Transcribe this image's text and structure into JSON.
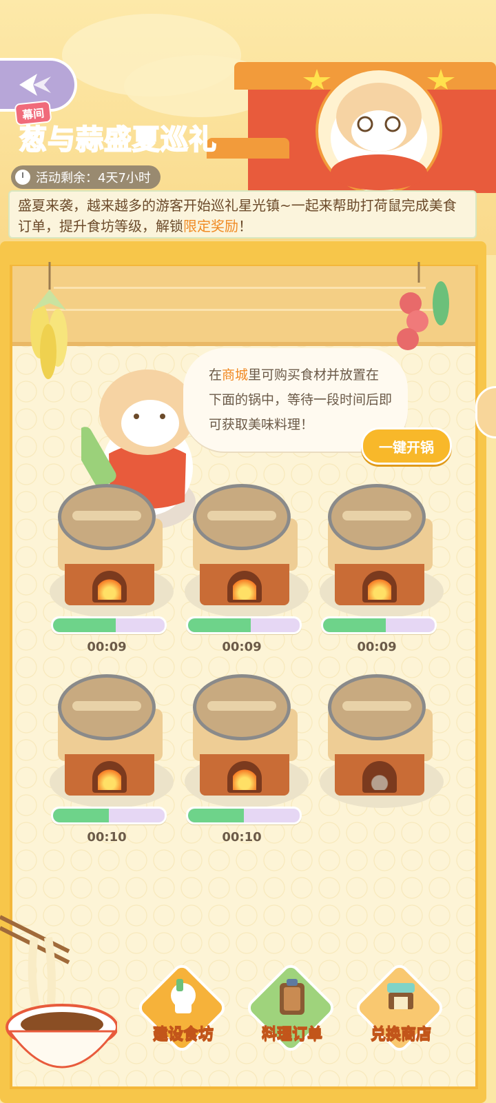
{
  "header": {
    "tag": "幕间",
    "title_part1": "葱与蒜",
    "title_part2": "盛夏巡礼",
    "timer_label": "活动剩余：",
    "timer_value": "4天7小时",
    "description_part1": "盛夏来袭，越来越多的游客开始巡礼星光镇~一起来帮助打荷鼠完成美食订单，提升食坊等级，解锁",
    "description_highlight": "限定奖励",
    "description_end": "！"
  },
  "bubble": {
    "prefix": "在",
    "highlight": "商城",
    "rest": "里可购买食材并放置在下面的锅中，等待一段时间后即可获取美味料理！"
  },
  "open_all_button": "一键开锅",
  "stoves": [
    {
      "time": "00:09",
      "progress": 0.56,
      "fire": true
    },
    {
      "time": "00:09",
      "progress": 0.56,
      "fire": true
    },
    {
      "time": "00:09",
      "progress": 0.56,
      "fire": true
    },
    {
      "time": "00:10",
      "progress": 0.5,
      "fire": true
    },
    {
      "time": "00:10",
      "progress": 0.5,
      "fire": true
    },
    {
      "time": "",
      "progress": 0,
      "fire": false
    }
  ],
  "nav": {
    "build": "建设食坊",
    "orders": "料理订单",
    "shop": "兑换商店"
  },
  "colors": {
    "accent": "#f08a24",
    "progress_fill": "#6ed38a",
    "progress_track": "#e6d7f4",
    "title_green": "#2f9a49"
  }
}
